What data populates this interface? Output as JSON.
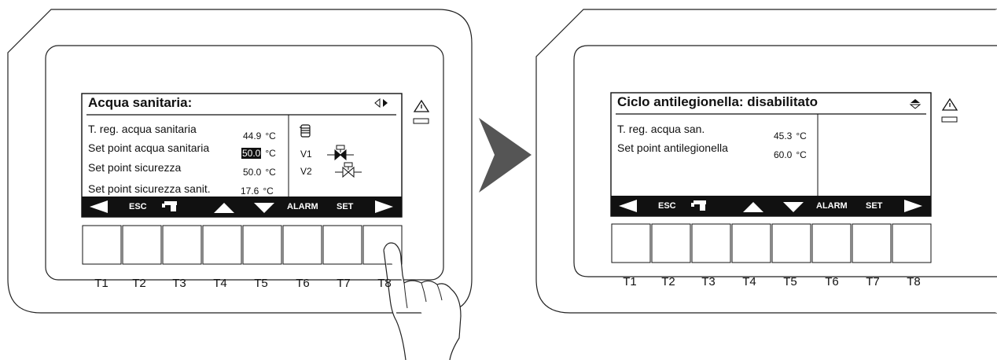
{
  "left_panel": {
    "title": "Acqua sanitaria:",
    "nav_icon": "left-right-arrows-icon",
    "rows": [
      {
        "label": "T. reg. acqua sanitaria",
        "value": "44.9",
        "unit": "°C"
      },
      {
        "label": "Set point acqua sanitaria",
        "value": "50.0",
        "unit": "°C",
        "selected": true
      },
      {
        "label": "Set point sicurezza",
        "value": "50.0",
        "unit": "°C"
      },
      {
        "label": "Set point sicurezza sanit.",
        "value": "17.6",
        "unit": "°C"
      }
    ],
    "status": {
      "tank_icon": "boiler-icon",
      "valves": [
        "V1",
        "V2"
      ],
      "valve_icon": "valve-icon"
    },
    "keybar": {
      "esc": "ESC",
      "alarm": "ALARM",
      "set": "SET"
    },
    "keys": [
      "T1",
      "T2",
      "T3",
      "T4",
      "T5",
      "T6",
      "T7",
      "T8"
    ]
  },
  "right_panel": {
    "title": "Ciclo antilegionella: disabilitato",
    "nav_icon": "up-down-arrows-icon",
    "rows": [
      {
        "label": "T. reg. acqua san.",
        "value": "45.3",
        "unit": "°C"
      },
      {
        "label": "Set point antilegionella",
        "value": "60.0",
        "unit": "°C"
      }
    ],
    "keybar": {
      "esc": "ESC",
      "alarm": "ALARM",
      "set": "SET"
    },
    "keys": [
      "T1",
      "T2",
      "T3",
      "T4",
      "T5",
      "T6",
      "T7",
      "T8"
    ]
  },
  "icons": [
    "warning-icon",
    "hand-pointer-icon",
    "transition-arrow-icon",
    "tap-icon"
  ],
  "colors": {
    "screen_ink": "#111111",
    "keybar_bg": "#111111",
    "arrow_gray": "#555555"
  }
}
